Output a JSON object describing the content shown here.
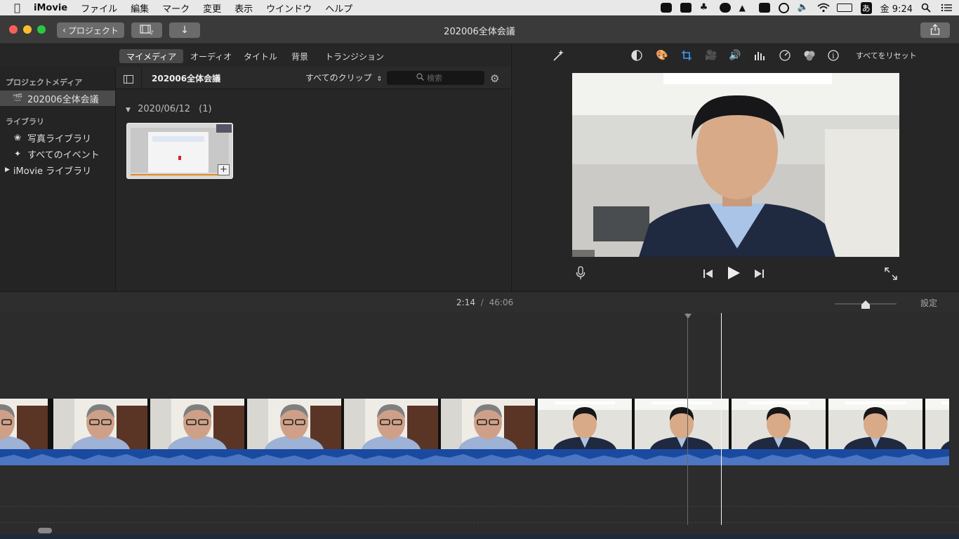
{
  "menubar": {
    "apple": "",
    "app_name": "iMovie",
    "items": [
      "ファイル",
      "編集",
      "マーク",
      "変更",
      "表示",
      "ウインドウ",
      "ヘルプ"
    ],
    "input_method": "あ",
    "clock": "金 9:24"
  },
  "titlebar": {
    "back_label": "プロジェクト",
    "document_title": "202006全体会議"
  },
  "browser_tabs": [
    "マイメディア",
    "オーディオ",
    "タイトル",
    "背景",
    "トランジション"
  ],
  "sidebar": {
    "project_media_header": "プロジェクトメディア",
    "project_item": "202006全体会議",
    "libraries_header": "ライブラリ",
    "library_items": [
      "写真ライブラリ",
      "すべてのイベント"
    ],
    "imovie_library": "iMovie ライブラリ"
  },
  "browser": {
    "title": "202006全体会議",
    "filter": "すべてのクリップ",
    "search_placeholder": "検索",
    "date_group": "2020/06/12",
    "date_count": "(1)"
  },
  "viewer": {
    "reset_all": "すべてをリセット"
  },
  "timeline": {
    "current_time": "2:14",
    "separator": "/",
    "total_time": "46:06",
    "settings": "設定",
    "zoom_level": 0.5
  },
  "colors": {
    "accent_blue": "#1a5fb4",
    "selected_tab": "#4a4a4a",
    "audio_wave": "#1f4f9e"
  }
}
